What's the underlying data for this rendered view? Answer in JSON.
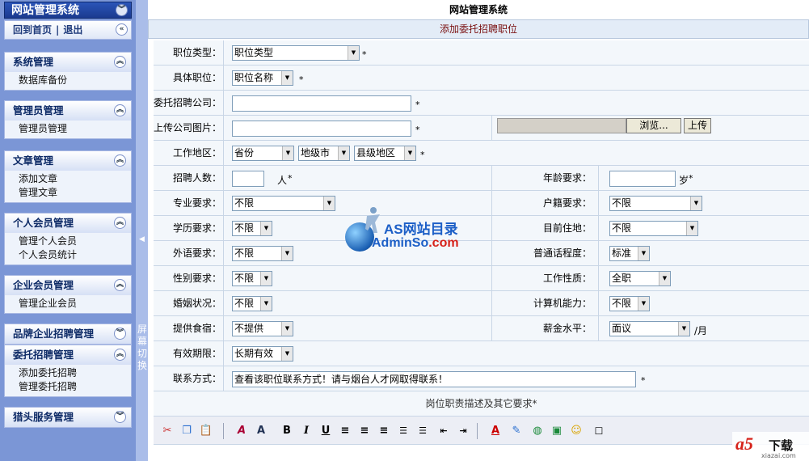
{
  "app": {
    "title": "网站管理系统"
  },
  "sidebar": {
    "title": "网站管理系统",
    "home_label": "回到首页",
    "separator": "|",
    "logout_label": "退出",
    "groups": [
      {
        "title": "系统管理",
        "items": [
          "数据库备份"
        ]
      },
      {
        "title": "管理员管理",
        "items": [
          "管理员管理"
        ]
      },
      {
        "title": "文章管理",
        "items": [
          "添加文章",
          "管理文章"
        ]
      },
      {
        "title": "个人会员管理",
        "items": [
          "管理个人会员",
          "个人会员统计"
        ]
      },
      {
        "title": "企业会员管理",
        "items": [
          "管理企业会员"
        ]
      },
      {
        "title": "品牌企业招聘管理",
        "items": []
      },
      {
        "title": "委托招聘管理",
        "items": [
          "添加委托招聘",
          "管理委托招聘"
        ]
      },
      {
        "title": "猎头服务管理",
        "items": []
      }
    ],
    "switch_label": "屏幕切换"
  },
  "main": {
    "page_title": "网站管理系统",
    "form_title": "添加委托招聘职位",
    "required_mark": "*",
    "fields": {
      "job_type": {
        "label": "职位类型：",
        "value": "职位类型"
      },
      "job_name": {
        "label": "具体职位：",
        "value": "职位名称"
      },
      "company": {
        "label": "委托招聘公司：",
        "value": ""
      },
      "company_image": {
        "label": "上传公司图片：",
        "value": "",
        "browse": "浏览...",
        "upload": "上传"
      },
      "work_area": {
        "label": "工作地区：",
        "province": "省份",
        "city": "地级市",
        "county": "县级地区"
      },
      "headcount": {
        "label": "招聘人数：",
        "value": "",
        "unit": "人"
      },
      "age": {
        "label": "年龄要求：",
        "value": "",
        "unit": "岁"
      },
      "major": {
        "label": "专业要求：",
        "value": "不限"
      },
      "hukou": {
        "label": "户籍要求：",
        "value": "不限"
      },
      "education": {
        "label": "学历要求：",
        "value": "不限"
      },
      "residence": {
        "label": "目前住地：",
        "value": "不限"
      },
      "language": {
        "label": "外语要求：",
        "value": "不限"
      },
      "mandarin": {
        "label": "普通话程度：",
        "value": "标准"
      },
      "gender": {
        "label": "性别要求：",
        "value": "不限"
      },
      "work_type": {
        "label": "工作性质：",
        "value": "全职"
      },
      "marriage": {
        "label": "婚姻状况：",
        "value": "不限"
      },
      "computer": {
        "label": "计算机能力：",
        "value": "不限"
      },
      "board": {
        "label": "提供食宿：",
        "value": "不提供"
      },
      "salary": {
        "label": "薪金水平：",
        "value": "面议",
        "unit": "/月"
      },
      "validity": {
        "label": "有效期限：",
        "value": "长期有效"
      },
      "contact": {
        "label": "联系方式：",
        "value": "查看该职位联系方式！请与烟台人才网取得联系！"
      }
    },
    "description_label": "岗位职责描述及其它要求*"
  },
  "editor_toolbar": [
    "cut-icon",
    "copy-icon",
    "paste-icon",
    "font-style-icon",
    "font-size-icon",
    "bold-icon",
    "italic-icon",
    "underline-icon",
    "align-left-icon",
    "align-center-icon",
    "align-right-icon",
    "ordered-list-icon",
    "unordered-list-icon",
    "outdent-icon",
    "indent-icon",
    "font-color-icon",
    "highlight-icon",
    "link-icon",
    "image-icon",
    "emoticon-icon",
    "checkbox-icon"
  ],
  "watermarks": {
    "center_line1": "AS网站目录",
    "center_line2_a": "AdminSo",
    "center_line2_b": ".com",
    "corner_logo": "a5",
    "corner_text": "下载",
    "corner_site": "xiazai.com"
  },
  "colors": {
    "sidebar_bg": "#7b96d6",
    "accent": "#1b3a8f",
    "form_title": "#7a1010"
  }
}
